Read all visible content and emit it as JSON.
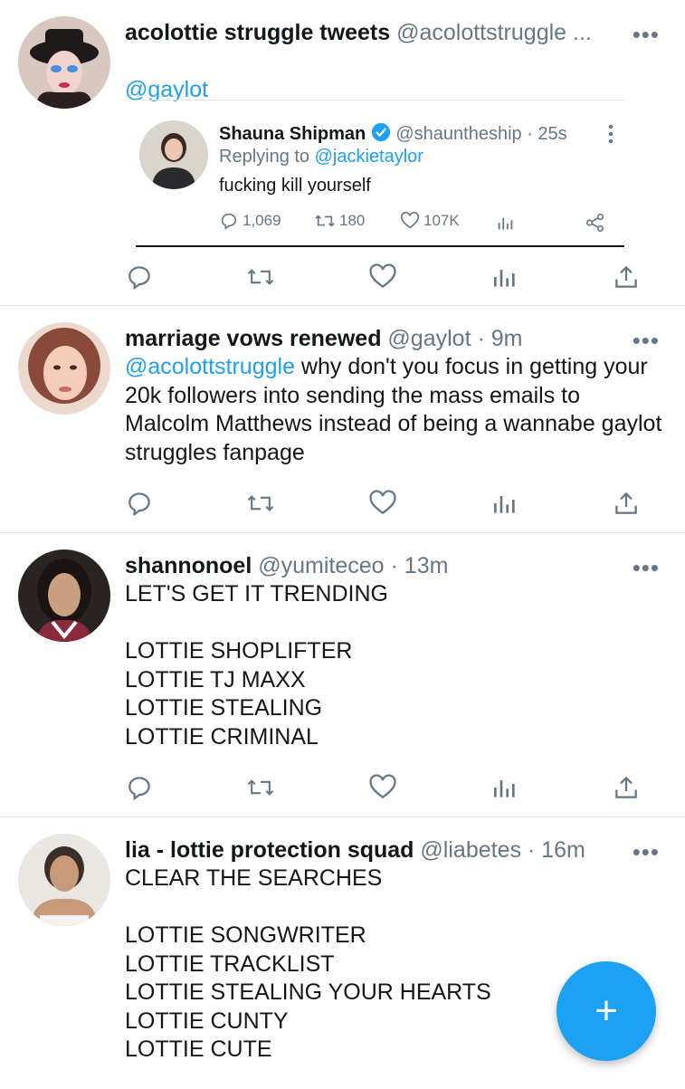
{
  "tweets": [
    {
      "name": "acolottie struggle tweets",
      "handle": "@acolottstruggle ...",
      "reply_to": "@gaylot",
      "quote": {
        "name": "Shauna Shipman",
        "handle": "@shauntheship · 25s",
        "replying_prefix": "Replying to ",
        "replying_to": "@jackietaylor",
        "text": "fucking kill yourself",
        "replies": "1,069",
        "retweets": "180",
        "likes": "107K"
      }
    },
    {
      "name": "marriage vows renewed",
      "handle": "@gaylot · 9m",
      "mention": "@acolottstruggle",
      "text": " why don't you focus in getting your 20k followers into sending the mass emails to Malcolm Matthews instead of being a wannabe gaylot struggles fanpage"
    },
    {
      "name": "shannonoel",
      "handle": "@yumiteceo · 13m",
      "text": "LET'S GET IT TRENDING\n\nLOTTIE SHOPLIFTER\nLOTTIE TJ MAXX\nLOTTIE STEALING\nLOTTIE CRIMINAL"
    },
    {
      "name": "lia - lottie protection squad",
      "handle": "@liabetes · 16m",
      "text": "CLEAR THE SEARCHES\n\nLOTTIE SONGWRITER\nLOTTIE TRACKLIST\nLOTTIE STEALING YOUR HEARTS\nLOTTIE CUNTY\nLOTTIE CUTE"
    }
  ],
  "more_label": "•••",
  "fab_label": "+",
  "colors": {
    "accent": "#1da1f2",
    "text": "#14171a",
    "muted": "#657786",
    "divider": "#e1e8ed"
  },
  "icons": [
    "reply-icon",
    "retweet-icon",
    "like-icon",
    "analytics-icon",
    "share-icon",
    "verified-icon",
    "more-icon",
    "compose-icon"
  ]
}
